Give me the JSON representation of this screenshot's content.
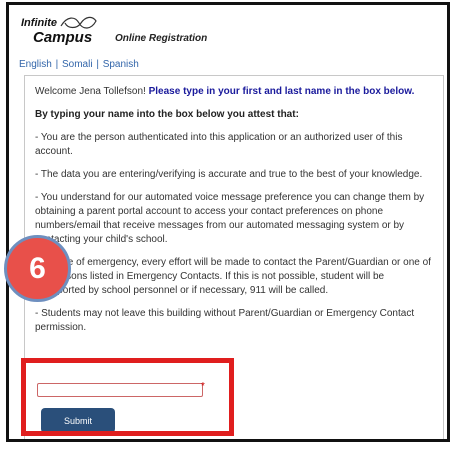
{
  "header": {
    "logo_top": "Infinite",
    "logo_bottom": "Campus",
    "title": "Online Registration"
  },
  "languages": [
    "English",
    "Somali",
    "Spanish"
  ],
  "form": {
    "welcome": "Welcome Jena Tollefson!",
    "instruction": "Please type in your first and last name in the box below.",
    "attest_heading": "By typing your name into the box below you attest that:",
    "statements": [
      "- You are the person authenticated into this application or an authorized user of this account.",
      "- The data you are entering/verifying is accurate and true to the best of your knowledge.",
      "- You understand for our automated voice message preference you can change them by obtaining a parent portal account to access your contact preferences on phone numbers/email that receive messages from our automated messaging system or by contacting your child's school.",
      "- In case of emergency, every effort will be made to contact the Parent/Guardian or one of the persons listed in Emergency Contacts. If this is not possible, student will be transported by school personnel or if necessary, 911 will be called.",
      "- Students may not leave this building without Parent/Guardian or Emergency Contact permission."
    ],
    "name_value": "",
    "required_marker": "*",
    "submit_label": "Submit"
  },
  "overlay": {
    "step_number": "6",
    "badge_color": "#e8504a",
    "highlight_color": "#e01e1e"
  }
}
